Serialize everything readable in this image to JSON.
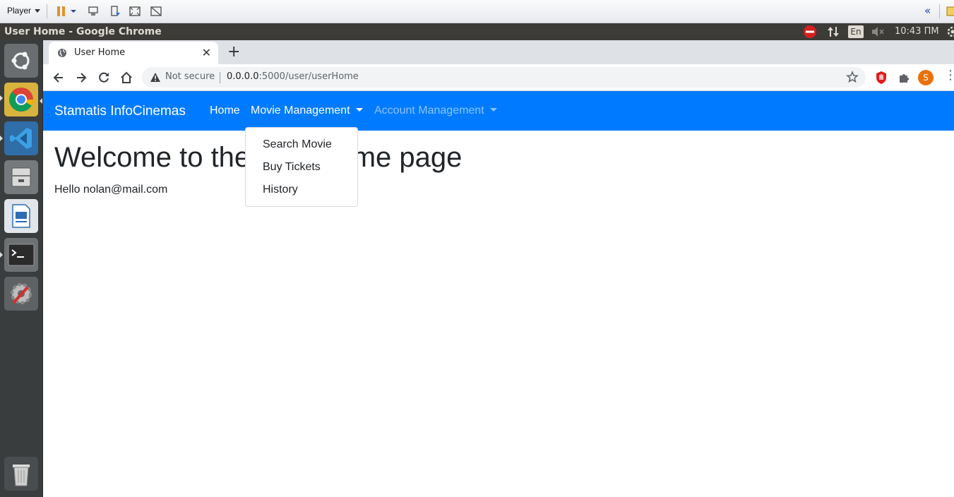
{
  "player_bar": {
    "menu_label": "Player"
  },
  "panel": {
    "window_title": "User Home - Google Chrome",
    "keyboard_layout": "En",
    "clock": "10:43 ПМ"
  },
  "launcher": {
    "items": [
      "ubuntu-dash",
      "chrome",
      "vscode",
      "files",
      "libreoffice-impress",
      "terminal",
      "system-settings",
      "trash"
    ]
  },
  "browser": {
    "tab_title": "User Home",
    "security_label": "Not secure",
    "url_host": "0.0.0.0",
    "url_rest": ":5000/user/userHome",
    "profile_initial": "S",
    "profile_color": "#e8710a"
  },
  "site": {
    "brand": "Stamatis InfoCinemas",
    "nav": {
      "home": "Home",
      "movie_management": "Movie Management",
      "account_management": "Account Management"
    },
    "dropdown": [
      "Search Movie",
      "Buy Tickets",
      "History"
    ],
    "heading": "Welcome to the user home page",
    "greeting": "Hello nolan@mail.com",
    "accent_color": "#007bff"
  }
}
